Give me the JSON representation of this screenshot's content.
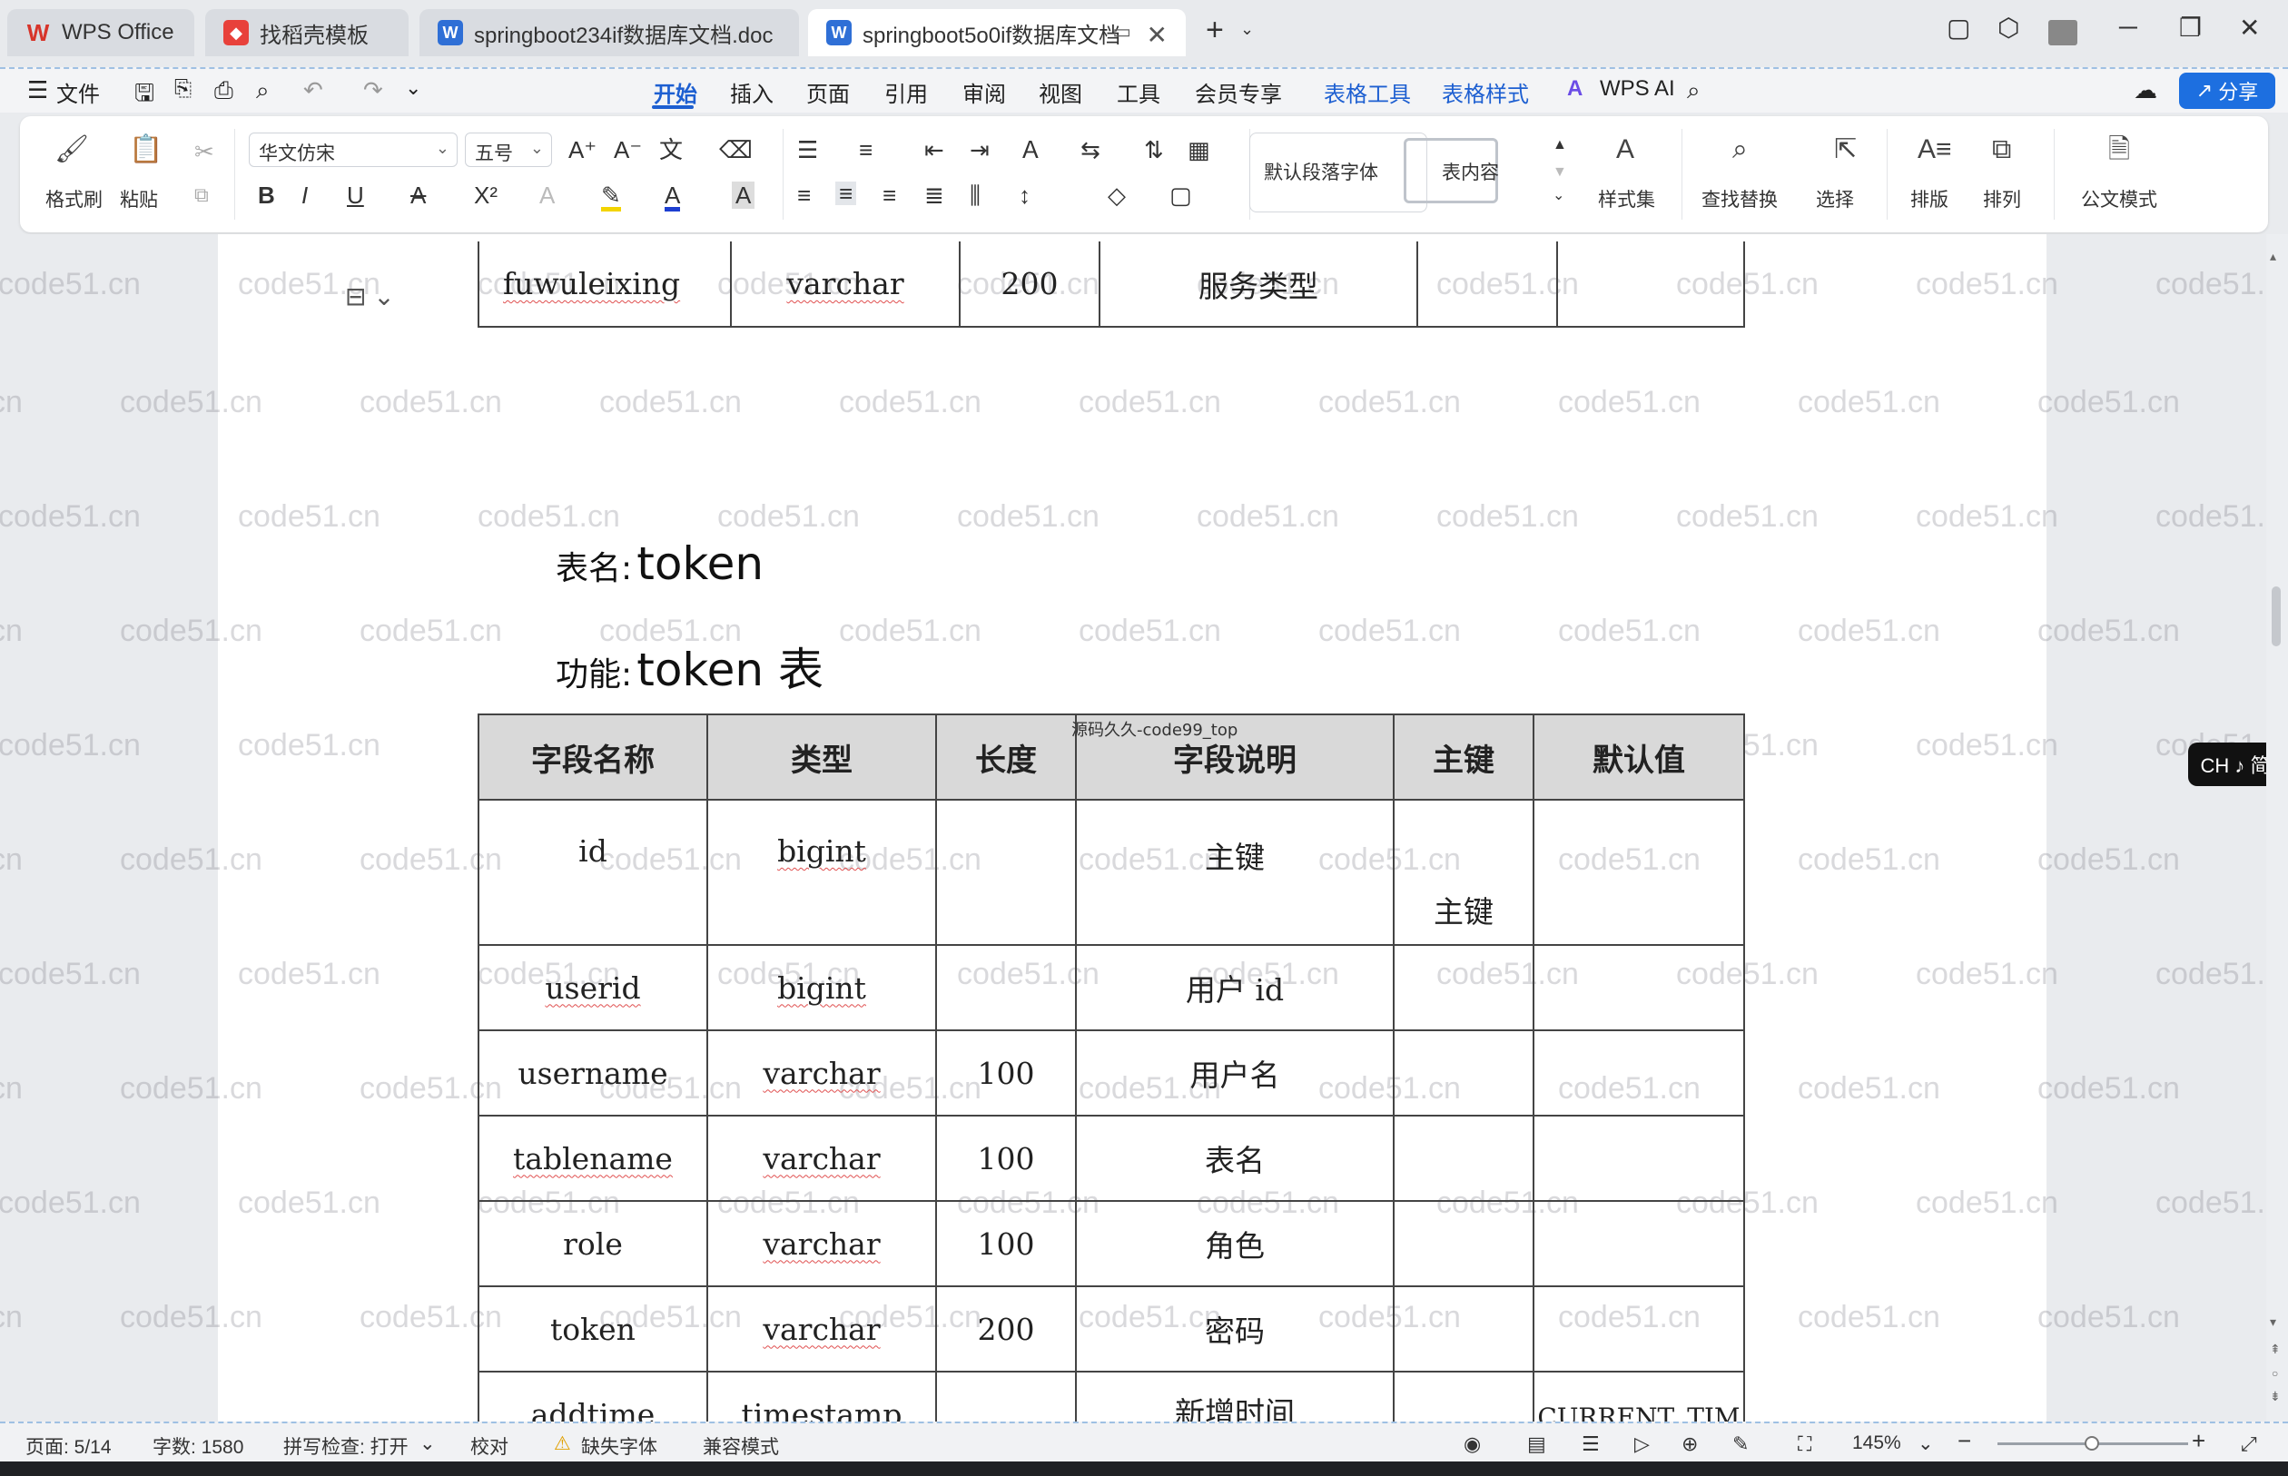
{
  "titlebar": {
    "tabs": [
      {
        "label": "WPS Office",
        "icon": "wps-logo-icon",
        "color": "#d7342a"
      },
      {
        "label": "找稻壳模板",
        "icon": "docer-icon",
        "color": "#e8413b"
      },
      {
        "label": "springboot234if数据库文档.doc",
        "icon": "word-doc-icon",
        "color": "#2f6fd6"
      },
      {
        "label": "springboot5o0if数据库文档",
        "icon": "word-doc-icon",
        "color": "#2f6fd6"
      }
    ],
    "new_tab": "+"
  },
  "menubar": {
    "file": "文件",
    "items": [
      "开始",
      "插入",
      "页面",
      "引用",
      "审阅",
      "视图",
      "工具",
      "会员专享",
      "表格工具",
      "表格样式"
    ],
    "active": "开始",
    "wps_ai": "WPS AI",
    "share": "分享"
  },
  "ribbon": {
    "format_painter": "格式刷",
    "paste": "粘贴",
    "font_name": "华文仿宋",
    "font_size": "五号",
    "style_default": "默认段落字体",
    "style_table": "表内容",
    "styles": "样式集",
    "find_replace": "查找替换",
    "select": "选择",
    "layout": "排版",
    "arrange": "排列",
    "official": "公文模式",
    "accent": "#1d5fd1"
  },
  "document": {
    "prev_row": [
      "fuwuleixing",
      "varchar",
      "200",
      "服务类型",
      "",
      ""
    ],
    "table_label": "表名:",
    "table_name": "token",
    "func_label": "功能:",
    "func_value": "token 表",
    "header": [
      "字段名称",
      "类型",
      "长度",
      "字段说明",
      "主键",
      "默认值"
    ],
    "header_note": "源码久久-code99_top",
    "rows": [
      [
        "id",
        "bigint",
        "",
        "主键",
        "主键",
        ""
      ],
      [
        "userid",
        "bigint",
        "",
        "用户 id",
        "",
        ""
      ],
      [
        "username",
        "varchar",
        "100",
        "用户名",
        "",
        ""
      ],
      [
        "tablename",
        "varchar",
        "100",
        "表名",
        "",
        ""
      ],
      [
        "role",
        "varchar",
        "100",
        "角色",
        "",
        ""
      ],
      [
        "token",
        "varchar",
        "200",
        "密码",
        "",
        ""
      ],
      [
        "addtime",
        "timestamp",
        "",
        "新增时间",
        "",
        "CURRENT_TIM"
      ]
    ],
    "watermark": "code51.cn"
  },
  "side_pill": "CH ♪ 简",
  "statusbar": {
    "page": "页面: 5/14",
    "words": "字数: 1580",
    "spell": "拼写检查: 打开",
    "proof": "校对",
    "missing_font": "缺失字体",
    "compat": "兼容模式",
    "zoom": "145%"
  }
}
